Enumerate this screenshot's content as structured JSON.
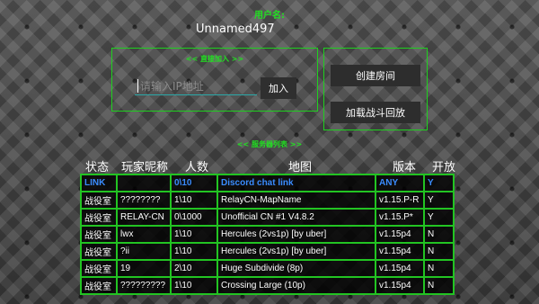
{
  "header": {
    "username_label": "用户名:",
    "username": "Unnamed497"
  },
  "direct_join": {
    "title": "<< 直接加入 >>",
    "ip_placeholder": "请输入IP地址",
    "join_label": "加入"
  },
  "side_buttons": {
    "create_room": "创建房间",
    "load_replay": "加载战斗回放"
  },
  "server_list": {
    "title": "<< 服务器列表 >>",
    "columns": [
      "状态",
      "玩家昵称",
      "人数",
      "地图",
      "版本",
      "开放"
    ],
    "link_row": [
      "LINK",
      "",
      "0\\10",
      "Discord chat link",
      "ANY",
      "Y"
    ],
    "rows": [
      [
        "战役室",
        "????????",
        "1\\10",
        "RelayCN-MapName",
        "v1.15.P-R",
        "Y"
      ],
      [
        "战役室",
        "RELAY-CN",
        "0\\1000",
        "Unofficial CN #1 V4.8.2",
        "v1.15.P*",
        "Y"
      ],
      [
        "战役室",
        "lwx",
        "1\\10",
        "Hercules (2vs1p) [by uber]",
        "v1.15p4",
        "N"
      ],
      [
        "战役室",
        "?ii",
        "1\\10",
        "Hercules (2vs1p) [by uber]",
        "v1.15p4",
        "N"
      ],
      [
        "战役室",
        "19",
        "2\\10",
        "Huge Subdivide (8p)",
        "v1.15p4",
        "N"
      ],
      [
        "战役室",
        "?????????",
        "1\\10",
        "Crossing Large (10p)",
        "v1.15p4",
        "N"
      ]
    ]
  },
  "colors": {
    "accent_green": "#22e022",
    "link_blue": "#3a8cff",
    "table_bg": "#000000"
  }
}
